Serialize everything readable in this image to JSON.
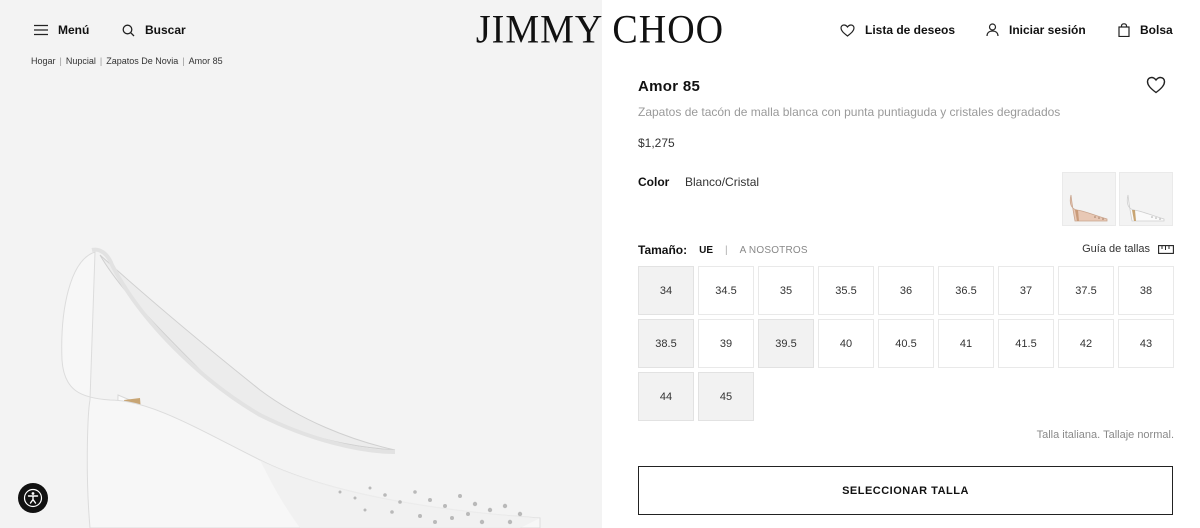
{
  "header": {
    "menu_label": "Menú",
    "search_label": "Buscar",
    "logo": "JIMMY CHOO",
    "wishlist_label": "Lista de deseos",
    "login_label": "Iniciar sesión",
    "bag_label": "Bolsa"
  },
  "breadcrumb": [
    "Hogar",
    "Nupcial",
    "Zapatos De Novia",
    "Amor 85"
  ],
  "product": {
    "name": "Amor 85",
    "description": "Zapatos de tacón de malla blanca con punta puntiaguda y cristales degradados",
    "price": "$1,275",
    "color_label": "Color",
    "color_value": "Blanco/Cristal"
  },
  "sizes": {
    "label": "Tamaño:",
    "system_ue": "UE",
    "separator": "|",
    "system_us": "A NOSOTROS",
    "guide_label": "Guía de tallas",
    "values": [
      "34",
      "34.5",
      "35",
      "35.5",
      "36",
      "36.5",
      "37",
      "37.5",
      "38",
      "38.5",
      "39",
      "39.5",
      "40",
      "40.5",
      "41",
      "41.5",
      "42",
      "43",
      "44",
      "45"
    ],
    "shaded": [
      "34",
      "38.5",
      "39.5",
      "44",
      "45"
    ],
    "note": "Talla italiana. Tallaje normal.",
    "select_button": "SELECCIONAR TALLA"
  },
  "colors": {
    "accent": "#111111",
    "muted_text": "#9a9a9a",
    "image_bg": "#f3f3f3"
  }
}
